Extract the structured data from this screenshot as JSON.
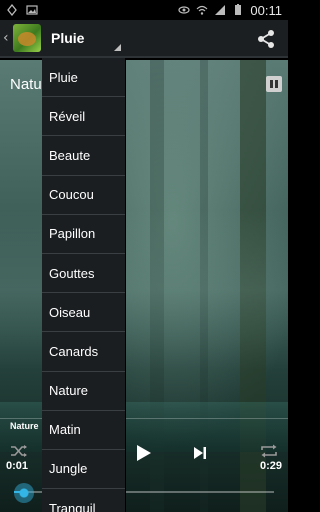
{
  "status_bar": {
    "time": "00:11",
    "icons": [
      "usb-debug-icon",
      "image-icon",
      "eye-icon",
      "wifi-icon",
      "signal-icon",
      "battery-icon"
    ]
  },
  "action_bar": {
    "title": "Pluie",
    "app_icon": "nature-app-icon",
    "share_icon": "share-icon"
  },
  "content": {
    "track_title": "Nature",
    "track_small": "Nature"
  },
  "player": {
    "current_time": "0:01",
    "total_time": "0:29",
    "progress": 0.03
  },
  "dropdown": {
    "items": [
      "Pluie",
      "Réveil",
      "Beaute",
      "Coucou",
      "Papillon",
      "Gouttes",
      "Oiseau",
      "Canards",
      "Nature",
      "Matin",
      "Jungle",
      "Tranquil"
    ]
  },
  "colors": {
    "accent": "#33b5e5",
    "actionbar_bg": "#1c1f22",
    "dropdown_bg": "#1b1e21"
  }
}
